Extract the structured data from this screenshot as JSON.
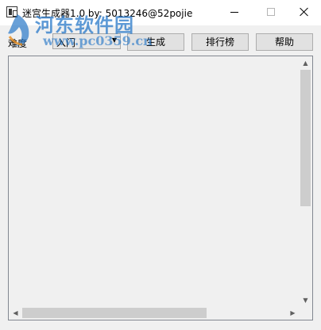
{
  "window": {
    "title": "迷宫生成器1.0 by: 5013246@52pojie"
  },
  "toolbar": {
    "difficulty_label": "难度",
    "difficulty_value": "入门",
    "generate_label": "生成",
    "rank_label": "排行榜",
    "help_label": "帮助"
  },
  "watermark": {
    "text": "河东软件园",
    "url": "www.pc0359.cn"
  },
  "icons": {
    "app": "app-icon",
    "dropdown": "chevron-down-icon",
    "scroll_up": "arrow-up-icon",
    "scroll_down": "arrow-down-icon",
    "scroll_left": "arrow-left-icon",
    "scroll_right": "arrow-right-icon"
  },
  "colors": {
    "watermark": "#2878c8",
    "background": "#f0f0f0"
  }
}
